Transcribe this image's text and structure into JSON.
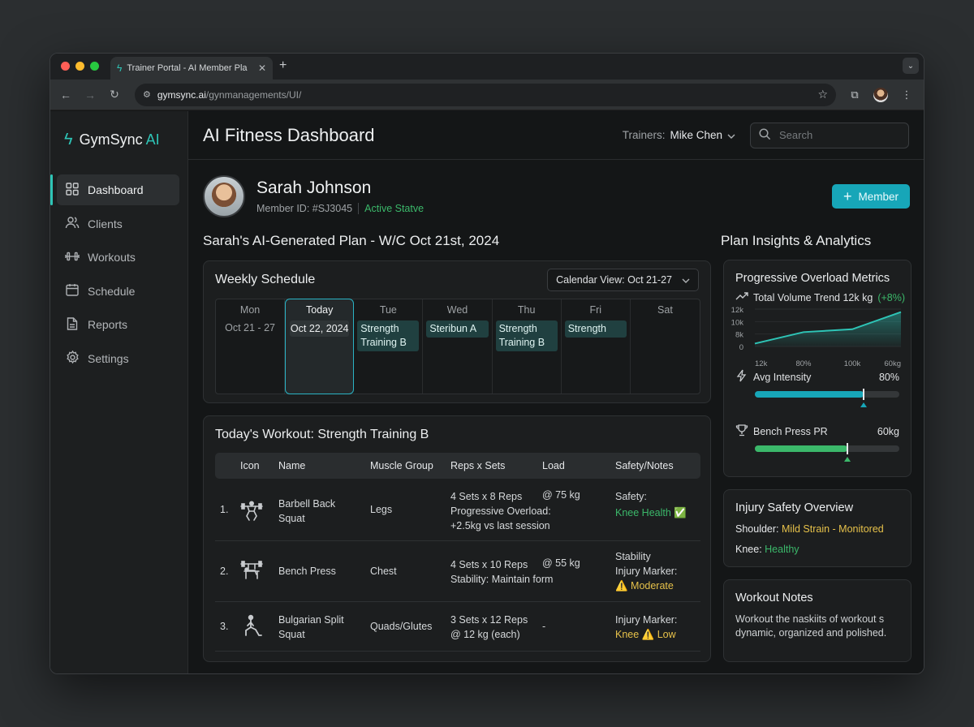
{
  "browser": {
    "tab_title": "Trainer Portal - AI Member Pla",
    "url_host": "gymsync.ai",
    "url_path": "/gynmanagements/UI/"
  },
  "sidebar": {
    "brand": "GymSync",
    "brand_ai": "AI",
    "items": [
      {
        "label": "Dashboard",
        "icon": "grid-icon",
        "active": true
      },
      {
        "label": "Clients",
        "icon": "users-icon"
      },
      {
        "label": "Workouts",
        "icon": "dumbbell-icon"
      },
      {
        "label": "Schedule",
        "icon": "calendar-icon"
      },
      {
        "label": "Reports",
        "icon": "document-icon"
      },
      {
        "label": "Settings",
        "icon": "gear-icon"
      }
    ]
  },
  "header": {
    "title": "AI Fitness Dashboard",
    "trainers_label": "Trainers:",
    "trainer_name": "Mike Chen",
    "search_placeholder": "Search"
  },
  "member": {
    "name": "Sarah Johnson",
    "id": "Member ID: #SJ3045",
    "status": "Active Statve",
    "add_button": "Member"
  },
  "plan_title": "Sarah's AI-Generated Plan - W/C Oct 21st, 2024",
  "schedule": {
    "title": "Weekly Schedule",
    "calendar_view": "Calendar View: Oct 21-27",
    "days": [
      {
        "name": "Mon",
        "sub": "Oct 21 - 27"
      },
      {
        "name": "Today",
        "sub": "Oct 22, 2024"
      },
      {
        "name": "Tue",
        "event": "Strength Training B"
      },
      {
        "name": "Wed",
        "event": "Steribun A"
      },
      {
        "name": "Thu",
        "event": "Strength Training B"
      },
      {
        "name": "Fri",
        "event": "Strength"
      },
      {
        "name": "Sat"
      }
    ]
  },
  "workout": {
    "title": "Today's Workout: Strength Training B",
    "columns": [
      "Icon",
      "Name",
      "Muscle Group",
      "Reps x Sets",
      "Load",
      "Safety/Notes"
    ],
    "rows": [
      {
        "num": "1.",
        "icon": "squat-icon",
        "name": "Barbell Back Squat",
        "muscle": "Legs",
        "reps": "4 Sets x 8 Reps",
        "reps_note1": "Progressive Overload:",
        "reps_note2": "+2.5kg vs last session",
        "load": "@ 75 kg",
        "safety_label": "Safety:",
        "safety_value": "Knee Health ✅"
      },
      {
        "num": "2.",
        "icon": "bench-press-icon",
        "name": "Bench Press",
        "muscle": "Chest",
        "reps": "4 Sets x 10 Reps",
        "reps_note1": "Stability: Maintain form",
        "load": "@ 55 kg",
        "safety_label": "Stability",
        "safety_label2": "Injury Marker:",
        "safety_value": "⚠️ Moderate"
      },
      {
        "num": "3.",
        "icon": "lunge-icon",
        "name": "Bulgarian Split Squat",
        "muscle": "Quads/Glutes",
        "reps": "3 Sets x 12 Reps",
        "reps_note1": "@ 12 kg (each)",
        "load": "-",
        "safety_label": "Injury Marker:",
        "safety_value": "Knee ⚠️ Low"
      }
    ]
  },
  "insights": {
    "title": "Plan Insights & Analytics",
    "overload": {
      "title": "Progressive Overload Metrics",
      "trend_label": "Total Volume Trend 12k kg",
      "trend_pct": "(+8%)",
      "chart_data": {
        "type": "area",
        "x": [
          "12k",
          "80%",
          "100k",
          "60kg"
        ],
        "values": [
          1,
          5,
          6,
          12
        ],
        "yticks": [
          "12k",
          "10k",
          "8k",
          "0"
        ],
        "ylim": [
          0,
          13
        ],
        "color": "#2ec4b6"
      },
      "intensity_label": "Avg Intensity",
      "intensity_value": "80%",
      "intensity_fraction": 0.75,
      "intensity_color": "#17a6b8",
      "bench_label": "Bench Press PR",
      "bench_value": "60kg",
      "bench_fraction": 0.64,
      "bench_color": "#3bb86a"
    },
    "injury": {
      "title": "Injury Safety Overview",
      "shoulder_label": "Shoulder:",
      "shoulder_value": "Mild Strain - Monitored",
      "knee_label": "Knee:",
      "knee_value": "Healthy"
    },
    "notes": {
      "title": "Workout Notes",
      "text": "Workout the naskiits of workout s dynamic, organized and polished."
    }
  }
}
